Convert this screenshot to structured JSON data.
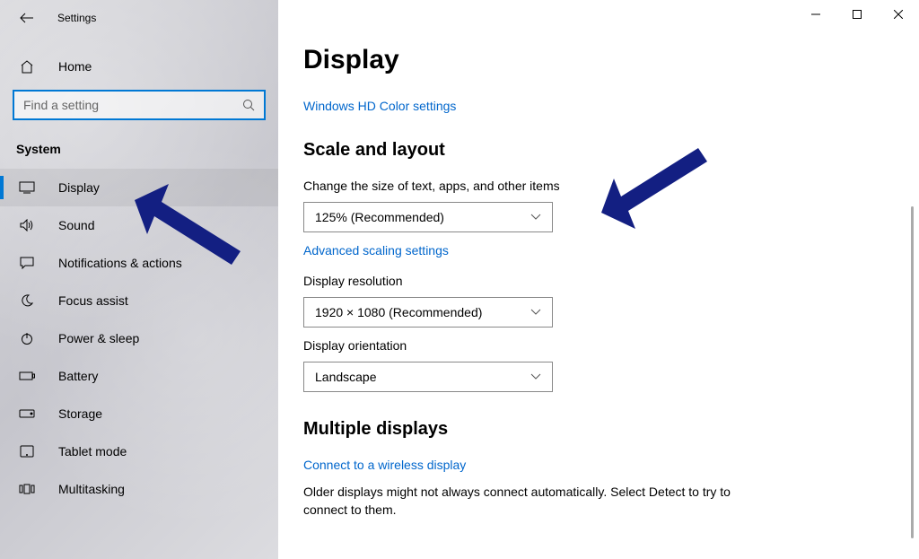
{
  "window": {
    "title": "Settings",
    "minimize_tooltip": "Minimize",
    "maximize_tooltip": "Maximize",
    "close_tooltip": "Close"
  },
  "sidebar": {
    "home_label": "Home",
    "search_placeholder": "Find a setting",
    "category": "System",
    "items": [
      {
        "id": "display",
        "label": "Display",
        "icon": "monitor-icon",
        "active": true
      },
      {
        "id": "sound",
        "label": "Sound",
        "icon": "speaker-icon",
        "active": false
      },
      {
        "id": "notifications",
        "label": "Notifications & actions",
        "icon": "comment-icon",
        "active": false
      },
      {
        "id": "focus-assist",
        "label": "Focus assist",
        "icon": "moon-icon",
        "active": false
      },
      {
        "id": "power-sleep",
        "label": "Power & sleep",
        "icon": "power-icon",
        "active": false
      },
      {
        "id": "battery",
        "label": "Battery",
        "icon": "battery-icon",
        "active": false
      },
      {
        "id": "storage",
        "label": "Storage",
        "icon": "storage-icon",
        "active": false
      },
      {
        "id": "tablet-mode",
        "label": "Tablet mode",
        "icon": "tablet-icon",
        "active": false
      },
      {
        "id": "multitasking",
        "label": "Multitasking",
        "icon": "multitask-icon",
        "active": false
      }
    ]
  },
  "main": {
    "page_title": "Display",
    "hd_color_link": "Windows HD Color settings",
    "scale_layout_heading": "Scale and layout",
    "scale_field_label": "Change the size of text, apps, and other items",
    "scale_value": "125% (Recommended)",
    "advanced_scaling_link": "Advanced scaling settings",
    "resolution_field_label": "Display resolution",
    "resolution_value": "1920 × 1080 (Recommended)",
    "orientation_field_label": "Display orientation",
    "orientation_value": "Landscape",
    "multiple_displays_heading": "Multiple displays",
    "wireless_link": "Connect to a wireless display",
    "older_displays_text": "Older displays might not always connect automatically. Select Detect to try to connect to them."
  },
  "annotations": {
    "arrow_color": "#131f82"
  }
}
